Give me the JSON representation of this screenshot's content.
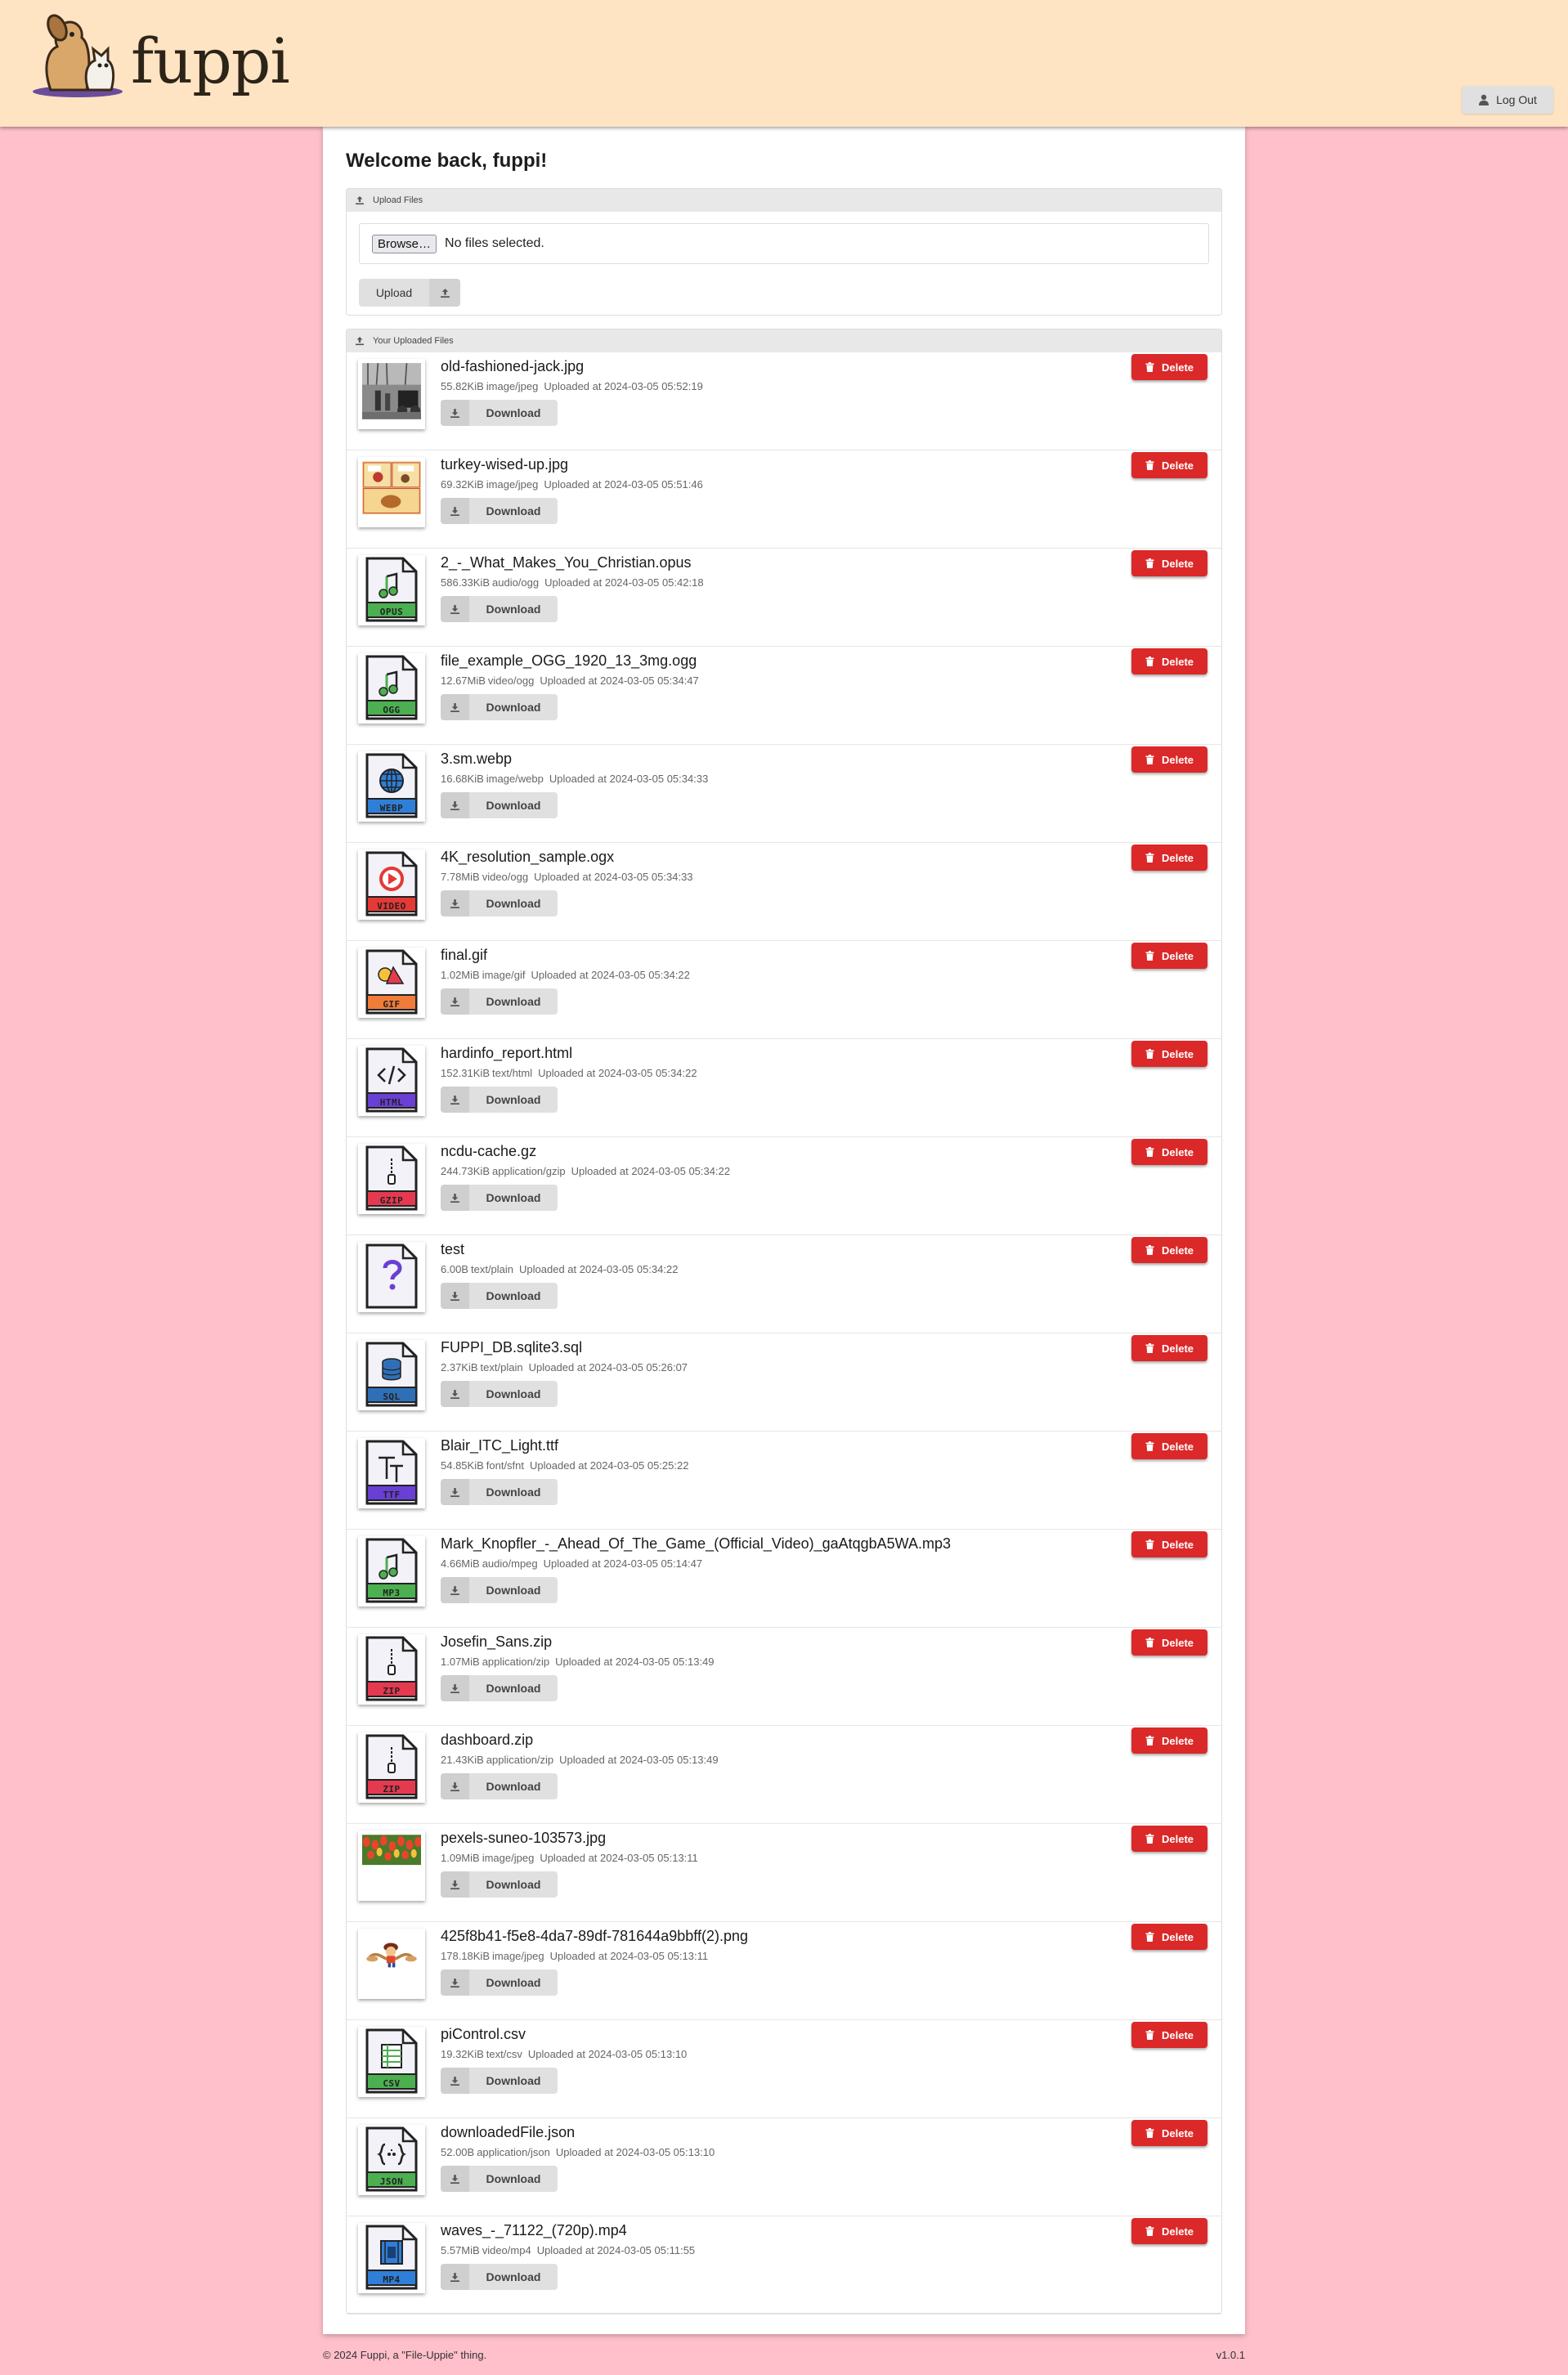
{
  "app": {
    "logo_text": "fuppi"
  },
  "header": {
    "logout_label": "Log Out"
  },
  "welcome": "Welcome back, fuppi!",
  "upload": {
    "section_title": "Upload Files",
    "browse_label": "Browse…",
    "no_file_text": "No files selected.",
    "button_label": "Upload"
  },
  "files_section": {
    "title": "Your Uploaded Files",
    "download_label": "Download",
    "delete_label": "Delete"
  },
  "files": [
    {
      "name": "old-fashioned-jack.jpg",
      "size": "55.82KiB",
      "mime": "image/jpeg",
      "uploaded": "Uploaded at 2024-03-05 05:52:19",
      "icon": "photo-bw"
    },
    {
      "name": "turkey-wised-up.jpg",
      "size": "69.32KiB",
      "mime": "image/jpeg",
      "uploaded": "Uploaded at 2024-03-05 05:51:46",
      "icon": "comic"
    },
    {
      "name": "2_-_What_Makes_You_Christian.opus",
      "size": "586.33KiB",
      "mime": "audio/ogg",
      "uploaded": "Uploaded at 2024-03-05 05:42:18",
      "icon": "music",
      "badge": "OPUS",
      "color": "#4caf50"
    },
    {
      "name": "file_example_OGG_1920_13_3mg.ogg",
      "size": "12.67MiB",
      "mime": "video/ogg",
      "uploaded": "Uploaded at 2024-03-05 05:34:47",
      "icon": "music",
      "badge": "OGG",
      "color": "#4caf50"
    },
    {
      "name": "3.sm.webp",
      "size": "16.68KiB",
      "mime": "image/webp",
      "uploaded": "Uploaded at 2024-03-05 05:34:33",
      "icon": "globe",
      "badge": "WEBP",
      "color": "#2f7ed8"
    },
    {
      "name": "4K_resolution_sample.ogx",
      "size": "7.78MiB",
      "mime": "video/ogg",
      "uploaded": "Uploaded at 2024-03-05 05:34:33",
      "icon": "play",
      "badge": "VIDEO",
      "color": "#e53935"
    },
    {
      "name": "final.gif",
      "size": "1.02MiB",
      "mime": "image/gif",
      "uploaded": "Uploaded at 2024-03-05 05:34:22",
      "icon": "shapes",
      "badge": "GIF",
      "color": "#f07c3a"
    },
    {
      "name": "hardinfo_report.html",
      "size": "152.31KiB",
      "mime": "text/html",
      "uploaded": "Uploaded at 2024-03-05 05:34:22",
      "icon": "code",
      "badge": "HTML",
      "color": "#6a3fd4"
    },
    {
      "name": "ncdu-cache.gz",
      "size": "244.73KiB",
      "mime": "application/gzip",
      "uploaded": "Uploaded at 2024-03-05 05:34:22",
      "icon": "zip",
      "badge": "GZIP",
      "color": "#e53950"
    },
    {
      "name": "test",
      "size": "6.00B",
      "mime": "text/plain",
      "uploaded": "Uploaded at 2024-03-05 05:34:22",
      "icon": "question",
      "color": "#6a3fd4"
    },
    {
      "name": "FUPPI_DB.sqlite3.sql",
      "size": "2.37KiB",
      "mime": "text/plain",
      "uploaded": "Uploaded at 2024-03-05 05:26:07",
      "icon": "database",
      "badge": "SQL",
      "color": "#2f6fb8"
    },
    {
      "name": "Blair_ITC_Light.ttf",
      "size": "54.85KiB",
      "mime": "font/sfnt",
      "uploaded": "Uploaded at 2024-03-05 05:25:22",
      "icon": "font",
      "badge": "TTF",
      "color": "#6a3fd4"
    },
    {
      "name": "Mark_Knopfler_-_Ahead_Of_The_Game_(Official_Video)_gaAtqgbA5WA.mp3",
      "size": "4.66MiB",
      "mime": "audio/mpeg",
      "uploaded": "Uploaded at 2024-03-05 05:14:47",
      "icon": "music",
      "badge": "MP3",
      "color": "#4caf50"
    },
    {
      "name": "Josefin_Sans.zip",
      "size": "1.07MiB",
      "mime": "application/zip",
      "uploaded": "Uploaded at 2024-03-05 05:13:49",
      "icon": "zip",
      "badge": "ZIP",
      "color": "#e53950"
    },
    {
      "name": "dashboard.zip",
      "size": "21.43KiB",
      "mime": "application/zip",
      "uploaded": "Uploaded at 2024-03-05 05:13:49",
      "icon": "zip",
      "badge": "ZIP",
      "color": "#e53950"
    },
    {
      "name": "pexels-suneo-103573.jpg",
      "size": "1.09MiB",
      "mime": "image/jpeg",
      "uploaded": "Uploaded at 2024-03-05 05:13:11",
      "icon": "photo-tulips"
    },
    {
      "name": "425f8b41-f5e8-4da7-89df-781644a9bbff(2).png",
      "size": "178.18KiB",
      "mime": "image/jpeg",
      "uploaded": "Uploaded at 2024-03-05 05:13:11",
      "icon": "photo-cartoon"
    },
    {
      "name": "piControl.csv",
      "size": "19.32KiB",
      "mime": "text/csv",
      "uploaded": "Uploaded at 2024-03-05 05:13:10",
      "icon": "sheet",
      "badge": "CSV",
      "color": "#4caf50"
    },
    {
      "name": "downloadedFile.json",
      "size": "52.00B",
      "mime": "application/json",
      "uploaded": "Uploaded at 2024-03-05 05:13:10",
      "icon": "braces",
      "badge": "JSON",
      "color": "#4caf50"
    },
    {
      "name": "waves_-_71122_(720p).mp4",
      "size": "5.57MiB",
      "mime": "video/mp4",
      "uploaded": "Uploaded at 2024-03-05 05:11:55",
      "icon": "film",
      "badge": "MP4",
      "color": "#2f7ed8"
    }
  ],
  "footer": {
    "copyright": "© 2024 Fuppi, a \"File-Uppie\" thing.",
    "version": "v1.0.1"
  }
}
